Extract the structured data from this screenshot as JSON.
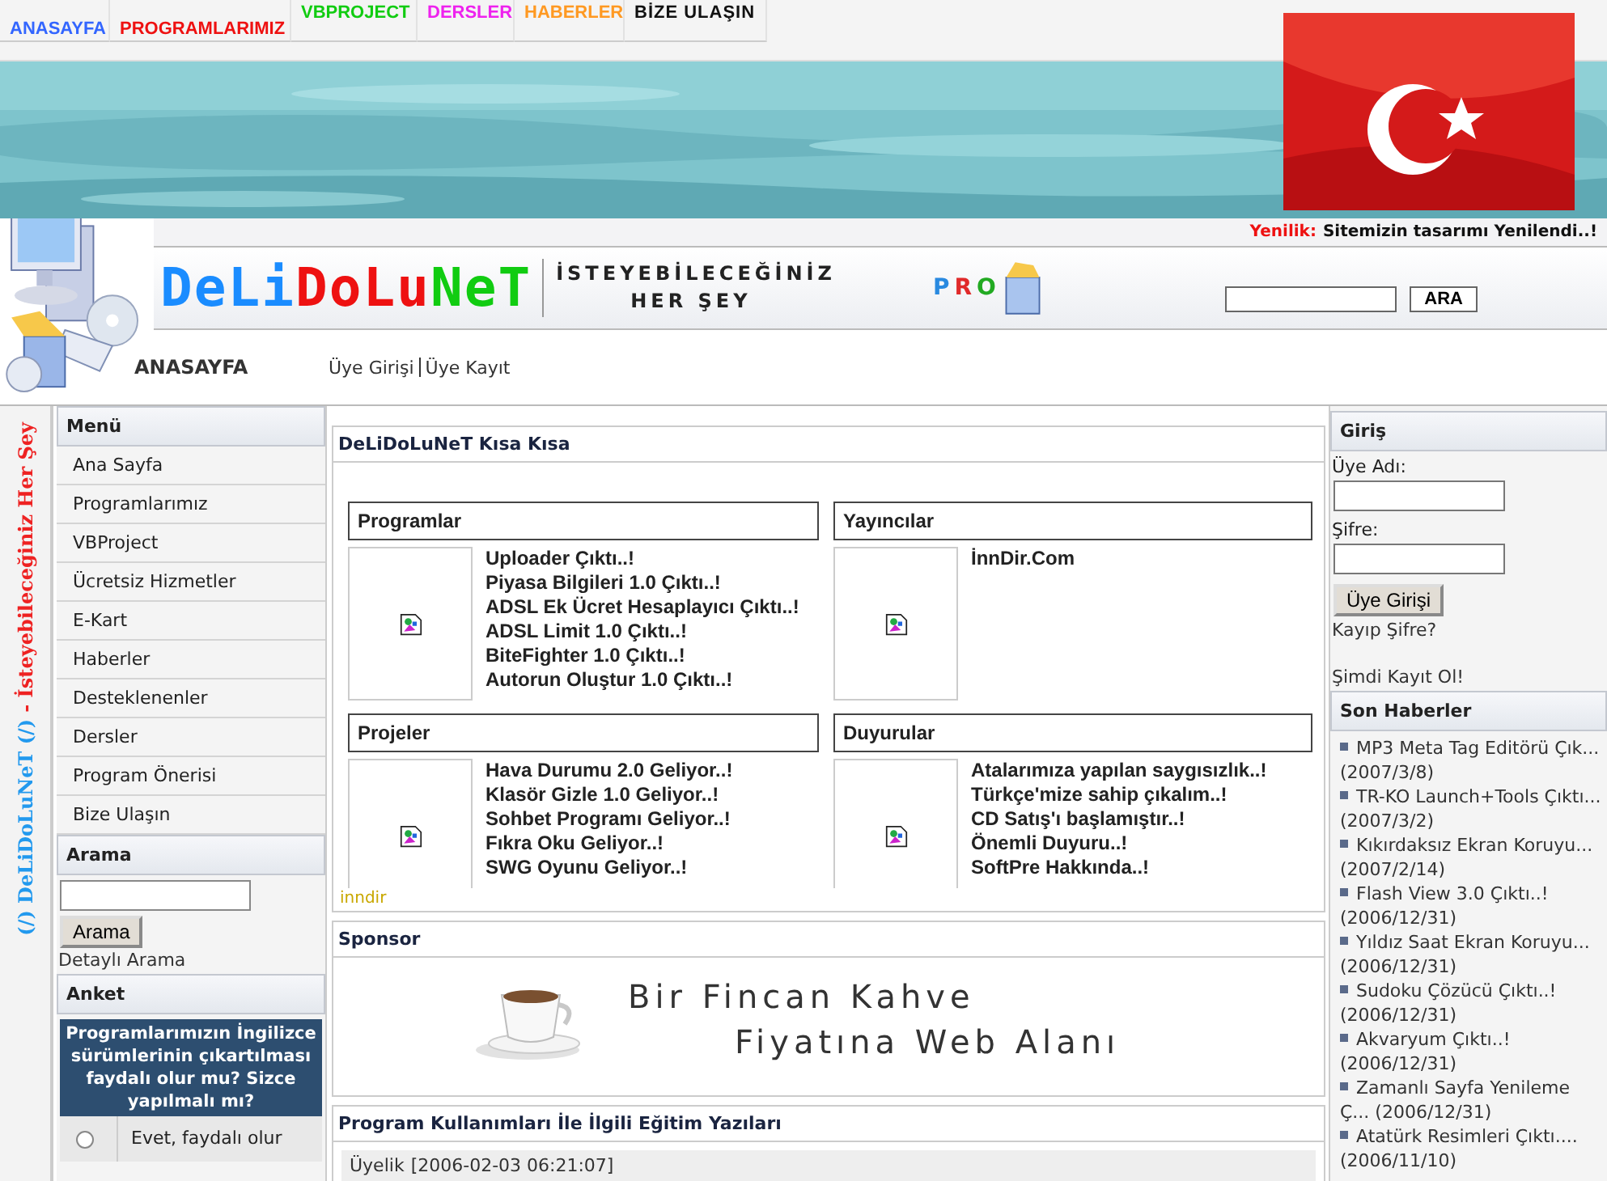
{
  "top_nav": [
    {
      "label": "ANASAYFA",
      "color": "#3366ff"
    },
    {
      "label": "PROGRAMLARIMIZ",
      "color": "#ee1111"
    },
    {
      "label": "VBPROJECT",
      "color": "#11cc11"
    },
    {
      "label": "DERSLER",
      "color": "#ee22ee"
    },
    {
      "label": "HABERLER",
      "color": "#ff9922"
    },
    {
      "label": "BİZE ULAŞIN",
      "color": "#111111"
    }
  ],
  "news_bar": {
    "label": "Yenilik:",
    "text": "Sitemizin tasarımı Yenilendi..!"
  },
  "logo": [
    {
      "text": "DeLi",
      "color": "#1a8cff"
    },
    {
      "text": "DoLu",
      "color": "#ee1111"
    },
    {
      "text": "NeT",
      "color": "#11cc11"
    }
  ],
  "tagline": [
    "İSTEYEBİLECEĞİNİZ",
    "HER ŞEY"
  ],
  "pro_logo": [
    {
      "text": "P",
      "color": "#2a8ae0"
    },
    {
      "text": "R",
      "color": "#e02a2a"
    },
    {
      "text": "O",
      "color": "#22aa22"
    }
  ],
  "header_search": {
    "button": "ARA"
  },
  "breadcrumb": {
    "current": "ANASAYFA",
    "links": [
      "Üye Girişi",
      "Üye Kayıt"
    ]
  },
  "vertical_title": [
    {
      "text": "(/) DeLiDoLuNeT (/)",
      "color": "#2299ee"
    },
    {
      "text": "- İsteyebileceğiniz Her Şey",
      "color": "#ee2222"
    }
  ],
  "menu": {
    "title": "Menü",
    "items": [
      "Ana Sayfa",
      "Programlarımız",
      "VBProject",
      "Ücretsiz Hizmetler",
      "E-Kart",
      "Haberler",
      "Desteklenenler",
      "Dersler",
      "Program Önerisi",
      "Bize Ulaşın"
    ]
  },
  "search": {
    "title": "Arama",
    "button": "Arama",
    "link": "Detaylı Arama"
  },
  "poll": {
    "title": "Anket",
    "question": "Programlarımızın İngilizce sürümlerinin çıkartılması faydalı olur mu? Sizce yapılmalı mı?",
    "options": [
      {
        "label": "Evet, faydalı olur",
        "selected": false
      }
    ]
  },
  "summary": {
    "title": "DeLiDoLuNeT Kısa Kısa",
    "boxes": [
      {
        "title": "Programlar",
        "items": [
          "Uploader Çıktı..!",
          "Piyasa Bilgileri 1.0 Çıktı..!",
          "ADSL Ek Ücret Hesaplayıcı Çıktı..!",
          "ADSL Limit 1.0 Çıktı..!",
          "BiteFighter 1.0 Çıktı..!",
          "Autorun Oluştur 1.0 Çıktı..!"
        ]
      },
      {
        "title": "Yayıncılar",
        "items": [
          "İnnDir.Com"
        ]
      },
      {
        "title": "Projeler",
        "items": [
          "Hava Durumu 2.0 Geliyor..!",
          "Klasör Gizle 1.0 Geliyor..!",
          "Sohbet Programı Geliyor..!",
          "Fıkra Oku Geliyor..!",
          "SWG Oyunu Geliyor..!"
        ]
      },
      {
        "title": "Duyurular",
        "items": [
          "Atalarımıza yapılan saygısızlık..!",
          "Türkçe'mize sahip çıkalım..!",
          "CD Satış'ı başlamıştır..!",
          "Önemli Duyuru..!",
          "SoftPre Hakkında..!"
        ]
      }
    ],
    "footer_text": "inndir"
  },
  "sponsor": {
    "title": "Sponsor",
    "banner": [
      "Bir Fincan Kahve",
      "Fiyatına Web Alanı"
    ]
  },
  "articles": {
    "title": "Program Kullanımları İle İlgili Eğitim Yazıları",
    "entry": {
      "title": "Üyelik",
      "date": "[2006-02-03 06:21:07]"
    }
  },
  "login": {
    "title": "Giriş",
    "username_label": "Üye Adı:",
    "password_label": "Şifre:",
    "button": "Üye Girişi",
    "links": [
      "Kayıp Şifre?",
      "Şimdi Kayıt Ol!"
    ]
  },
  "latest_news": {
    "title": "Son Haberler",
    "items": [
      {
        "title": "MP3 Meta Tag Editörü Çık...",
        "date": "(2007/3/8)"
      },
      {
        "title": "TR-KO Launch+Tools Çıktı...",
        "date": "(2007/3/2)"
      },
      {
        "title": "Kıkırdaksız Ekran Koruyu...",
        "date": "(2007/2/14)"
      },
      {
        "title": "Flash View 3.0 Çıktı..!",
        "date": "(2006/12/31)"
      },
      {
        "title": "Yıldız Saat Ekran Koruyu...",
        "date": "(2006/12/31)"
      },
      {
        "title": "Sudoku Çözücü Çıktı..!",
        "date": "(2006/12/31)"
      },
      {
        "title": "Akvaryum Çıktı..!",
        "date": "(2006/12/31)"
      },
      {
        "title": "Zamanlı Sayfa Yenileme Ç...",
        "date": "(2006/12/31)"
      },
      {
        "title": "Atatürk Resimleri Çıktı....",
        "date": "(2006/11/10)"
      }
    ]
  }
}
